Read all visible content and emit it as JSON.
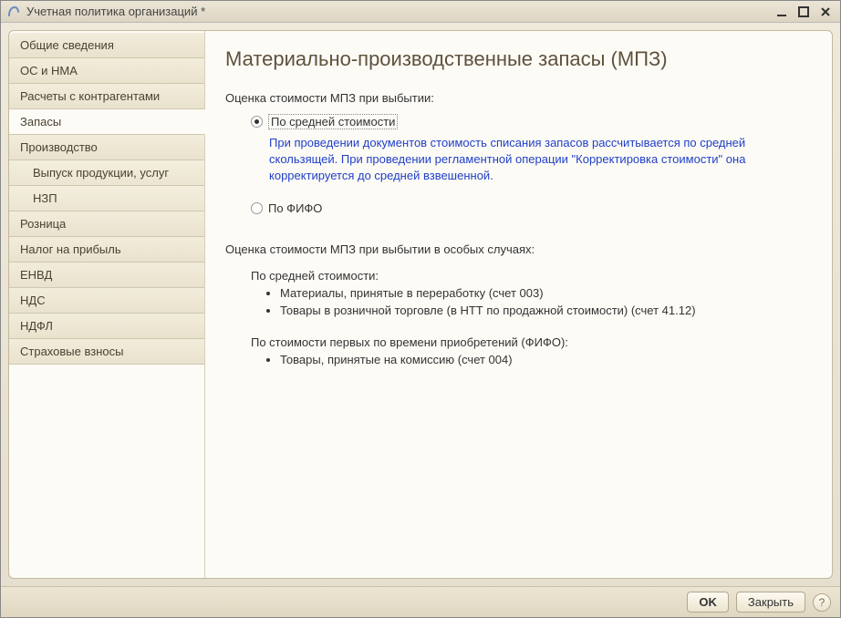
{
  "window": {
    "title": "Учетная политика организаций *"
  },
  "sidebar": {
    "items": [
      {
        "label": "Общие сведения",
        "sub": false
      },
      {
        "label": "ОС и НМА",
        "sub": false
      },
      {
        "label": "Расчеты с контрагентами",
        "sub": false
      },
      {
        "label": "Запасы",
        "sub": false,
        "active": true
      },
      {
        "label": "Производство",
        "sub": false
      },
      {
        "label": "Выпуск продукции, услуг",
        "sub": true
      },
      {
        "label": "НЗП",
        "sub": true
      },
      {
        "label": "Розница",
        "sub": false
      },
      {
        "label": "Налог на прибыль",
        "sub": false
      },
      {
        "label": "ЕНВД",
        "sub": false
      },
      {
        "label": "НДС",
        "sub": false
      },
      {
        "label": "НДФЛ",
        "sub": false
      },
      {
        "label": "Страховые взносы",
        "sub": false
      }
    ]
  },
  "main": {
    "title": "Материально-производственные запасы (МПЗ)",
    "section1_label": "Оценка стоимости МПЗ при выбытии:",
    "radio_avg": "По средней стоимости",
    "radio_avg_hint": "При проведении документов стоимость списания запасов рассчитывается по средней скользящей. При проведении регламентной операции \"Корректировка стоимости\" она корректируется до средней взвешенной.",
    "radio_fifo": "По ФИФО",
    "section2_label": "Оценка стоимости МПЗ при выбытии в особых случаях:",
    "sub_avg_heading": "По средней стоимости:",
    "sub_avg_items": [
      "Материалы, принятые в переработку (счет 003)",
      "Товары в розничной торговле (в НТТ по продажной стоимости) (счет 41.12)"
    ],
    "sub_fifo_heading": "По стоимости первых по времени приобретений (ФИФО):",
    "sub_fifo_items": [
      "Товары, принятые на комиссию (счет 004)"
    ]
  },
  "footer": {
    "ok": "OK",
    "close": "Закрыть",
    "help": "?"
  }
}
